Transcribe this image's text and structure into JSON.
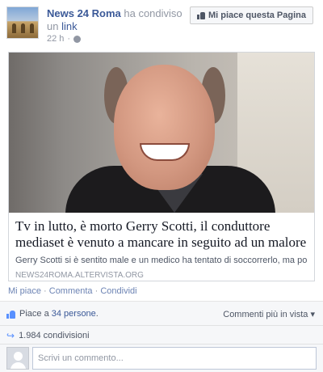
{
  "header": {
    "page_name": "News 24 Roma",
    "action_text": " ha condiviso un",
    "object_link": "link",
    "time": "22 h",
    "separator": "·",
    "like_page_label": "Mi piace questa Pagina",
    "icons": {
      "avatar": "page-avatar-colosseum",
      "privacy": "globe-icon",
      "like": "thumb-up-icon"
    }
  },
  "link_card": {
    "title": "Tv in lutto, è morto Gerry Scotti, il conduttore mediaset è venuto a mancare in seguito ad un malore",
    "description": "Gerry Scotti si è sentito male e un medico ha tentato di soccorrerlo, ma poi ha...",
    "domain": "NEWS24ROMA.ALTERVISTA.ORG"
  },
  "actions": {
    "like": "Mi piace",
    "comment": "Commenta",
    "share": "Condividi",
    "separator": " · "
  },
  "feedback": {
    "likes_prefix": "Piace a ",
    "likes_count": "34 persone",
    "likes_suffix": ".",
    "sort_label": "Commenti più in vista",
    "sort_arrow": "▾",
    "shares": "1.984 condivisioni",
    "comment_placeholder": "Scrivi un commento..."
  },
  "colors": {
    "link_blue": "#3b5998",
    "meta_grey": "#9197a3",
    "feedback_bg": "#f6f7f9",
    "like_blue": "#5890ff"
  }
}
